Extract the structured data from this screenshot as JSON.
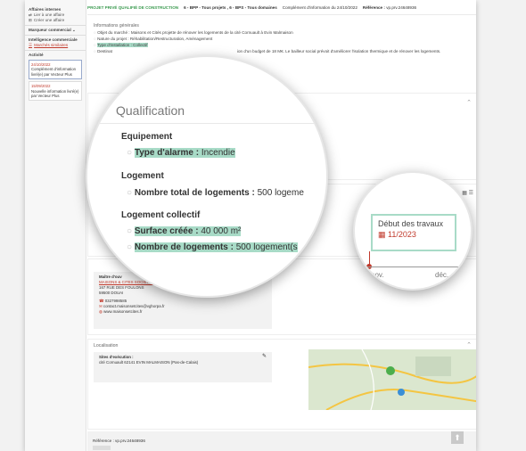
{
  "sidebar": {
    "internal_title": "Affaires internes",
    "link_affaire": "Lier à une affaire",
    "create_affaire": "Créer une affaire",
    "marker": "Marqueur commercial",
    "intel": "Intelligence commerciale",
    "similar": "Marchés similaires",
    "activity": "Activité",
    "activities": [
      {
        "date": "24/10/2022",
        "text": "Complément d'information livré(e) par Vecteur Plus"
      },
      {
        "date": "15/09/2022",
        "text": "Nouvelle information livré(e) par Vecteur Plus"
      }
    ]
  },
  "topbar": {
    "status": "PROJET PRIVÉ QUALIFIÉ DE CONSTRUCTION",
    "cat1": "6 - BPP - Tous projets , 6 - BPS - Tous domaines",
    "complement": "Complément d'information du 24/10/2022",
    "ref_label": "Référence :",
    "ref_value": "vp.prv.24648936"
  },
  "info": {
    "title": "Informations générales",
    "objet": "Objet du marché : Maisons et Cités projette de rénover les logements de la cité Cornuault à Evin Malmaison",
    "nature": "Nature du projet : Réhabilitation/Restructuration, Aménagement",
    "install": "Type d'installation : Collectif",
    "destination": "Destinat",
    "budget_fragment": "ion d'un budget de 18 M€. Le bailleur social prévoit d'améliorer l'isolation thermique et de rénover les logements."
  },
  "zoomA": {
    "title": "Qualification",
    "equip_head": "Equipement",
    "alarm_label": "Type d'alarme :",
    "alarm_value": "Incendie",
    "logement_head": "Logement",
    "total_label": "Nombre total de logements :",
    "total_value": "500 logeme",
    "coll_head": "Logement collectif",
    "surface_label": "Surface créée :",
    "surface_value": "40 000 m²",
    "nb_label": "Nombre de logements :",
    "nb_value": "500 logement(s"
  },
  "zoomB": {
    "start_label": "Début des travaux",
    "start_date": "11/2023",
    "month1": "nov.",
    "month2": "déc."
  },
  "contacts": {
    "title": "Maître d'ouv",
    "company": "MAISONS & CITES SOCIETE ANONYME D'HLM",
    "address1": "167 RUE DES FOULONS",
    "address2": "59500 DOUAI",
    "phone": "0327998585",
    "email": "contact.maisonsetcites@vghorpa.fr",
    "web": "www.maisonsetcites.fr"
  },
  "location": {
    "title": "Localisation",
    "sites_label": "Sites d'exécution :",
    "address": "cité Cornuault 62141 EVIN MALMAISON (Pas-de-Calais)"
  },
  "footer": {
    "ref": "Référence : vp.prv.24648936"
  }
}
